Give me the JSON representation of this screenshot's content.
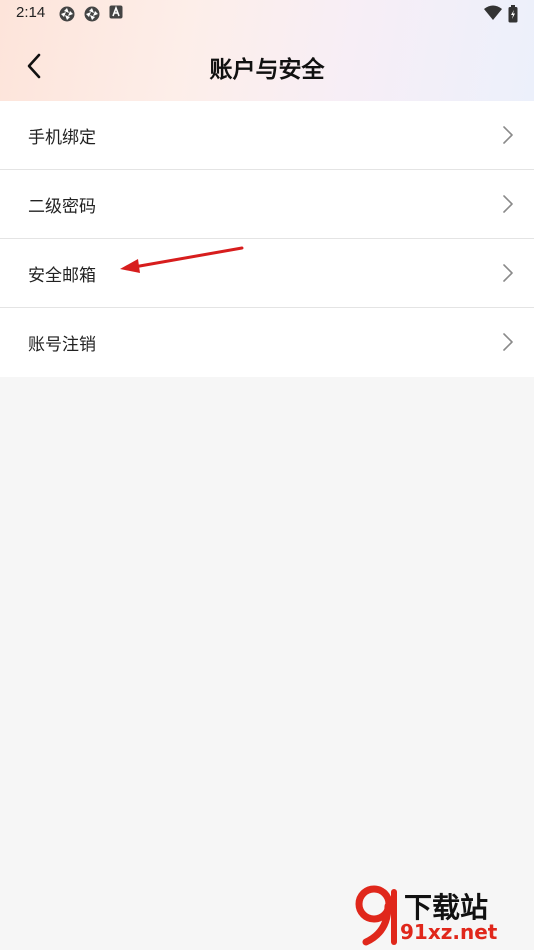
{
  "status_bar": {
    "time": "2:14"
  },
  "header": {
    "title": "账户与安全",
    "back_icon": "chevron-left-icon"
  },
  "menu": {
    "items": [
      {
        "label": "手机绑定"
      },
      {
        "label": "二级密码"
      },
      {
        "label": "安全邮箱"
      },
      {
        "label": "账号注销"
      }
    ]
  },
  "colors": {
    "annotation_arrow": "#d71d1d",
    "watermark_red": "#e0271b",
    "background": "#f6f6f6"
  },
  "watermark": {
    "title": "下载站",
    "url": "91xz.net"
  }
}
